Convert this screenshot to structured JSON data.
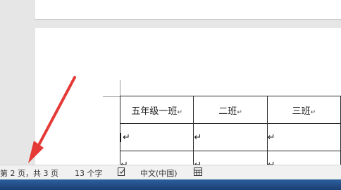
{
  "table": {
    "headers": [
      "五年级一班",
      "二班",
      "三班"
    ],
    "paragraph_mark": "↵"
  },
  "statusbar": {
    "page_info": "第 2 页，共 3 页",
    "word_count": "13 个字",
    "proofing_icon": "proofing-book-icon",
    "language": "中文(中国)",
    "layout_icon": "layout-grid-icon"
  },
  "annotation": {
    "arrow_color": "#e53935"
  },
  "colors": {
    "statusbar_bg": "#f1f1f1",
    "taskbar": "#1f4a82"
  }
}
